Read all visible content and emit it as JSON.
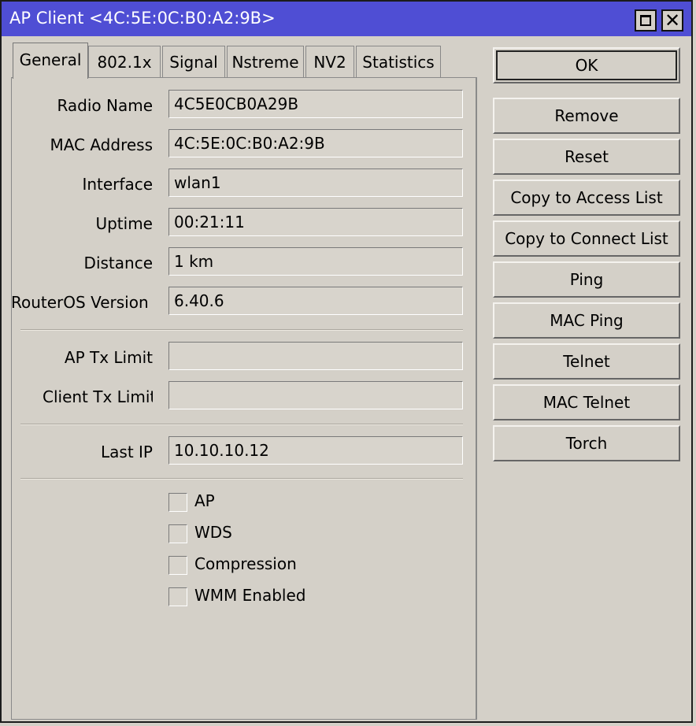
{
  "window": {
    "title": "AP Client <4C:5E:0C:B0:A2:9B>",
    "maximize_icon": "maximize-icon",
    "close_symbol": "✕"
  },
  "tabs": [
    {
      "label": "General",
      "active": true
    },
    {
      "label": "802.1x"
    },
    {
      "label": "Signal"
    },
    {
      "label": "Nstreme"
    },
    {
      "label": "NV2"
    },
    {
      "label": "Statistics"
    }
  ],
  "general": {
    "radio_name": {
      "label": "Radio Name",
      "value": "4C5E0CB0A29B"
    },
    "mac_address": {
      "label": "MAC Address",
      "value": "4C:5E:0C:B0:A2:9B"
    },
    "interface": {
      "label": "Interface",
      "value": "wlan1"
    },
    "uptime": {
      "label": "Uptime",
      "value": "00:21:11"
    },
    "distance": {
      "label": "Distance",
      "value": "1 km"
    },
    "routeros_version": {
      "label": "RouterOS Version",
      "value": "6.40.6"
    },
    "ap_tx_limit": {
      "label": "AP Tx Limit",
      "value": ""
    },
    "client_tx_limit": {
      "label": "Client Tx Limit",
      "value": ""
    },
    "last_ip": {
      "label": "Last IP",
      "value": "10.10.10.12"
    },
    "checkboxes": [
      {
        "label": "AP",
        "checked": false
      },
      {
        "label": "WDS",
        "checked": false
      },
      {
        "label": "Compression",
        "checked": false
      },
      {
        "label": "WMM Enabled",
        "checked": false
      }
    ]
  },
  "buttons": {
    "ok": "OK",
    "remove": "Remove",
    "reset": "Reset",
    "copy_access": "Copy to Access List",
    "copy_connect": "Copy to Connect List",
    "ping": "Ping",
    "mac_ping": "MAC Ping",
    "telnet": "Telnet",
    "mac_telnet": "MAC Telnet",
    "torch": "Torch"
  },
  "colors": {
    "titlebar": "#4f4ed4",
    "background": "#d4d0c8"
  }
}
